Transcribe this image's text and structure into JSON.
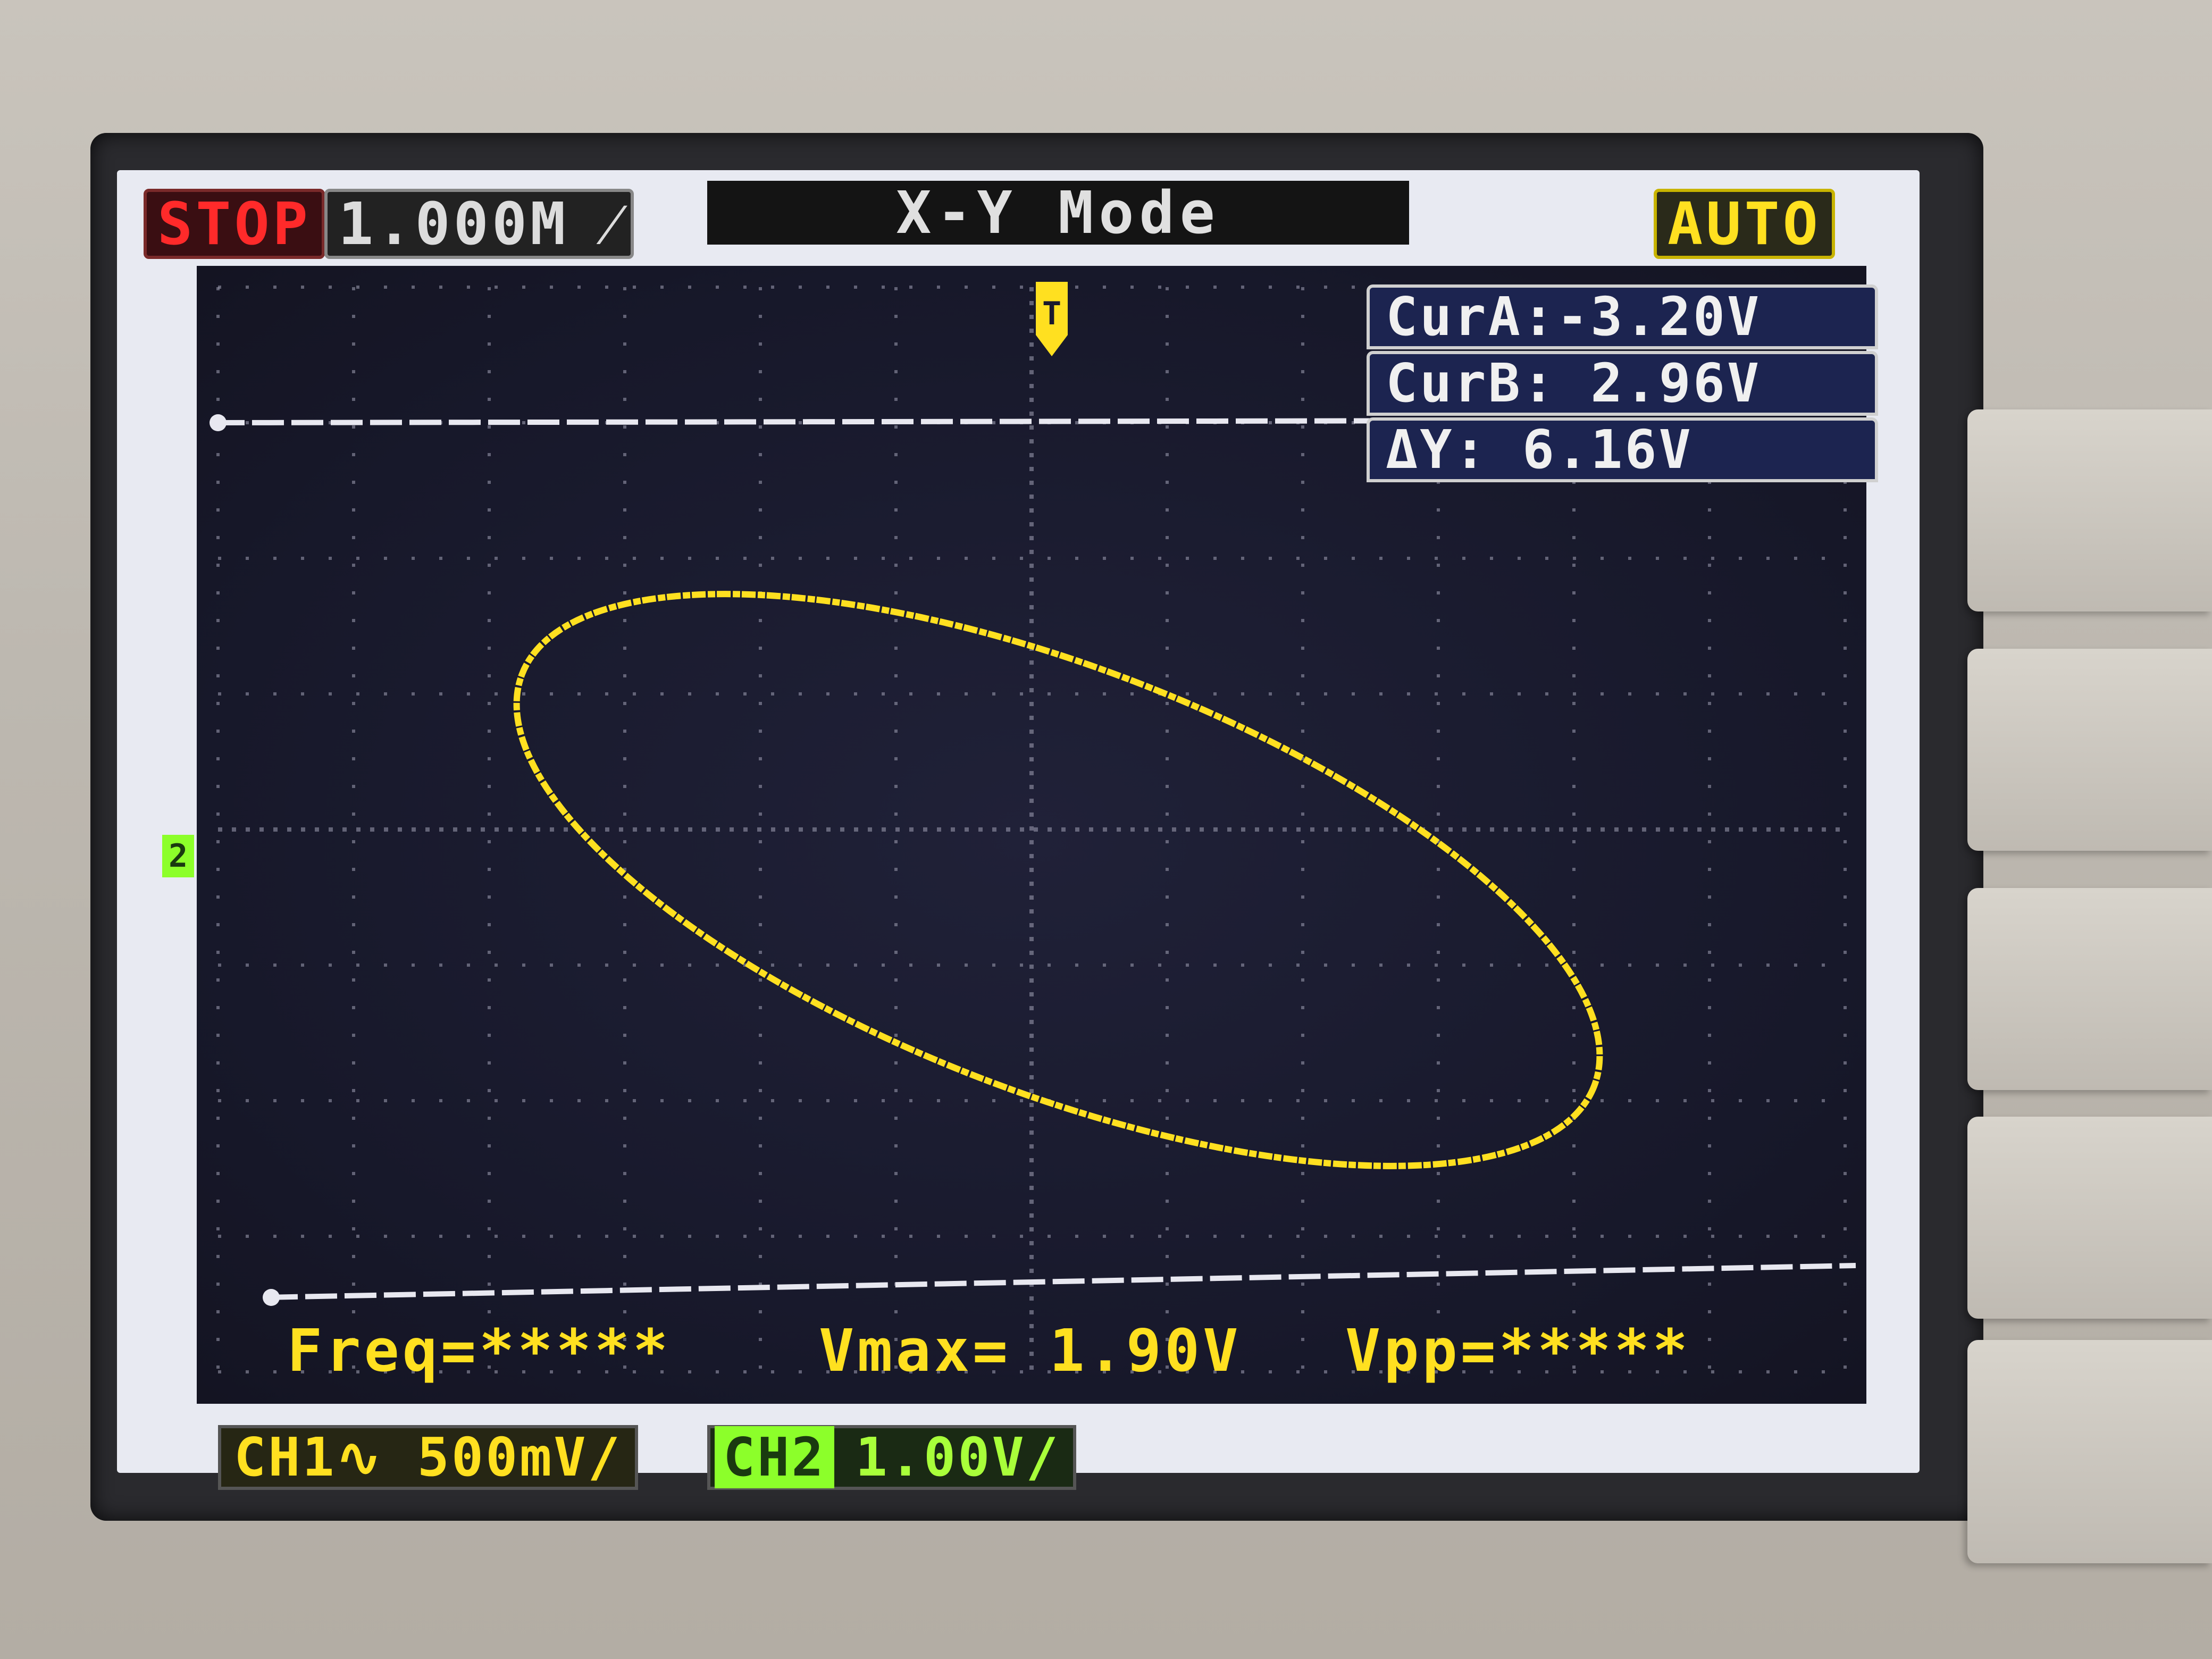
{
  "status": {
    "run_state": "STOP",
    "timebase": "1.000M ⁄",
    "mode": "X-Y  Mode",
    "trigger_mode": "AUTO"
  },
  "cursors": {
    "cur_a": "CurA:-3.20V",
    "cur_b": "CurB: 2.96V",
    "delta_y": "ΔY: 6.16V"
  },
  "measurements": {
    "freq": "Freq=*****",
    "vmax": "Vmax= 1.90V",
    "vpp": "Vpp=*****"
  },
  "channels": {
    "ch1": "CH1∿ 500mV/",
    "ch2_tag": "CH2",
    "ch2_scale": "1.00V/"
  },
  "markers": {
    "ch2_ground": "2",
    "trigger": "T"
  },
  "colors": {
    "trace": "#ffe020",
    "ch2": "#8cff2a",
    "grid": "#a0a0b4",
    "cursor_line": "#e8e8f0"
  }
}
